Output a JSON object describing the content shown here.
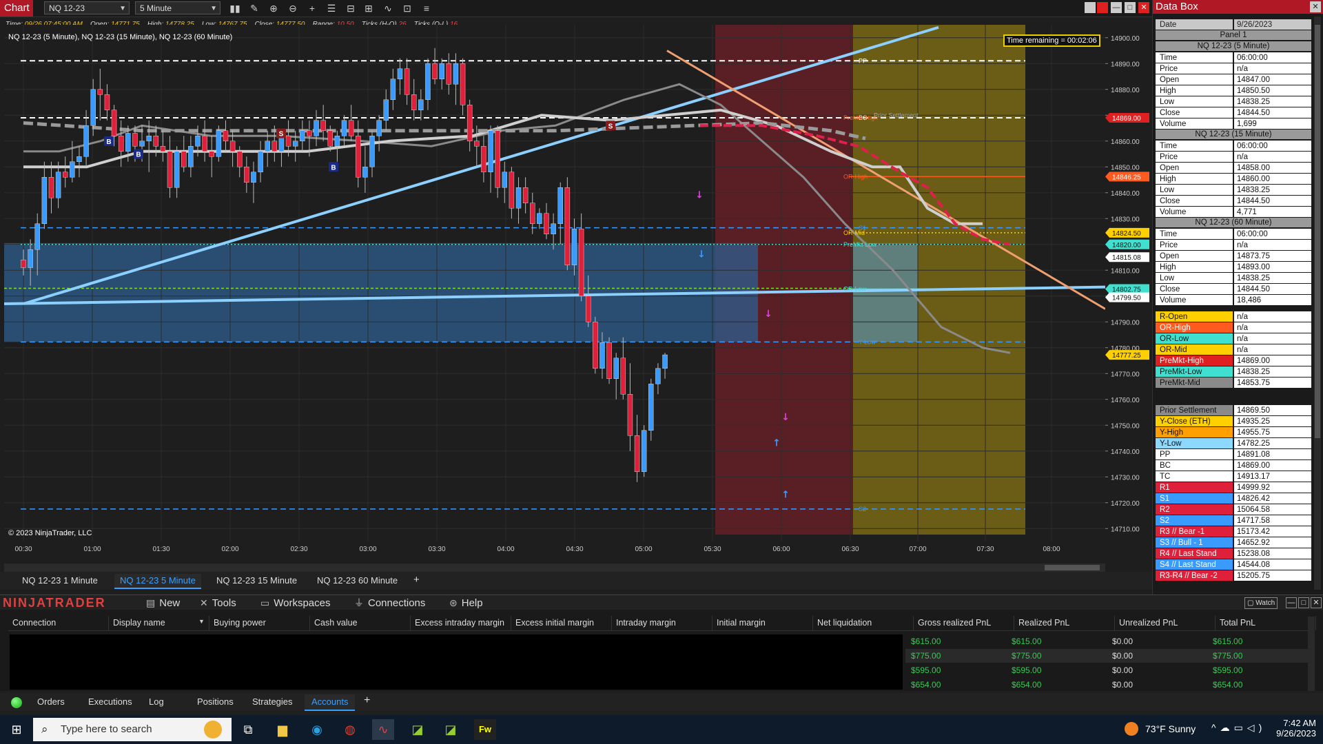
{
  "toolbar": {
    "title": "Chart",
    "instrument": "NQ 12-23",
    "interval": "5 Minute"
  },
  "infobar": {
    "time_label": "Time:",
    "time": "09/26 07:45:00 AM",
    "open_label": "Open:",
    "open": "14771.75",
    "high_label": "High:",
    "high": "14778.25",
    "low_label": "Low:",
    "low": "14767.75",
    "close_label": "Close:",
    "close": "14777.50",
    "range_label": "Range:",
    "range": "10.50",
    "ticks_ho_label": "Ticks (H-O)",
    "ticks_ho": "26",
    "ticks_ol_label": "Ticks (O-L)",
    "ticks_ol": "16"
  },
  "series_line": "NQ 12-23 (5 Minute), NQ 12-23 (15 Minute), NQ 12-23 (60 Minute)",
  "copyright": "© 2023 NinjaTrader, LLC",
  "time_remaining": "Time remaining = 00:02:06",
  "chart_data": {
    "type": "candlestick",
    "ylim": [
      14705,
      14905
    ],
    "yticks": [
      "14900.00",
      "14890.00",
      "14880.00",
      "14870.00",
      "14860.00",
      "14850.00",
      "14840.00",
      "14830.00",
      "14820.00",
      "14810.00",
      "14800.00",
      "14790.00",
      "14780.00",
      "14770.00",
      "14760.00",
      "14750.00",
      "14740.00",
      "14730.00",
      "14720.00",
      "14710.00"
    ],
    "x_labels": [
      "00:30",
      "01:00",
      "01:30",
      "02:00",
      "02:30",
      "03:00",
      "03:30",
      "04:00",
      "04:30",
      "05:00",
      "05:30",
      "06:00",
      "06:30",
      "07:00",
      "07:30",
      "08:00"
    ],
    "level_lines": [
      {
        "name": "PP",
        "value": 14891.08,
        "color": "#ffffff",
        "style": "dash"
      },
      {
        "name": "BC",
        "value": 14869.0,
        "color": "#ffffff",
        "style": "dash"
      },
      {
        "name": "S1",
        "value": 14826.42,
        "color": "#3a9bff",
        "style": "dash"
      },
      {
        "name": "Y-Low",
        "value": 14782.25,
        "color": "#3a9bff",
        "style": "dash"
      },
      {
        "name": "S2",
        "value": 14717.58,
        "color": "#3a9bff",
        "style": "dash"
      },
      {
        "name": "OR-High",
        "value": 14846.25,
        "color": "#ff5a1f",
        "style": "solid"
      },
      {
        "name": "OR-Mid",
        "value": 14824.5,
        "color": "#ffd000",
        "style": "dot"
      },
      {
        "name": "PreMkt-Low",
        "value": 14820.0,
        "color": "#40e0d0",
        "style": "dot"
      },
      {
        "name": "OR-Low",
        "value": 14802.75,
        "color": "#40e0d0",
        "style": "solid"
      }
    ],
    "level_labels": [
      "PP",
      "BC",
      "PreMkt-High",
      "Prior Settlement",
      "OR-High",
      "S1",
      "OR-Mid",
      "PreMkt-Low",
      "OR-Low",
      "Y-Low",
      "S2"
    ],
    "price_tags": [
      {
        "label": "14869.00",
        "value": 14869.0,
        "bg": "#e02020",
        "fg": "#fff"
      },
      {
        "label": "14846.25",
        "value": 14846.25,
        "bg": "#ff5a1f",
        "fg": "#fff"
      },
      {
        "label": "14824.50",
        "value": 14824.5,
        "bg": "#ffd000",
        "fg": "#111"
      },
      {
        "label": "14820.00",
        "value": 14820.0,
        "bg": "#40e0d0",
        "fg": "#111"
      },
      {
        "label": "14815.08",
        "value": 14815.08,
        "bg": "#ffffff",
        "fg": "#111"
      },
      {
        "label": "14802.75",
        "value": 14802.75,
        "bg": "#40e0d0",
        "fg": "#111"
      },
      {
        "label": "14799.50",
        "value": 14799.5,
        "bg": "#ffffff",
        "fg": "#111"
      },
      {
        "label": "14777.25",
        "value": 14777.25,
        "bg": "#ffd000",
        "fg": "#111"
      }
    ],
    "markers": [
      {
        "text": "B",
        "bg": "#1b2b8a"
      },
      {
        "text": "B",
        "bg": "#1b2b8a"
      },
      {
        "text": "B",
        "bg": "#1b2b8a"
      },
      {
        "text": "S",
        "bg": "#8a1b1b"
      },
      {
        "text": "S",
        "bg": "#8a1b1b"
      }
    ],
    "candles": [
      [
        14814,
        14818,
        14808,
        14811
      ],
      [
        14811,
        14822,
        14804,
        14818
      ],
      [
        14818,
        14832,
        14808,
        14828
      ],
      [
        14828,
        14852,
        14826,
        14846
      ],
      [
        14846,
        14852,
        14832,
        14838
      ],
      [
        14838,
        14852,
        14834,
        14848
      ],
      [
        14848,
        14854,
        14842,
        14846
      ],
      [
        14846,
        14860,
        14844,
        14852
      ],
      [
        14852,
        14858,
        14846,
        14854
      ],
      [
        14854,
        14872,
        14850,
        14866
      ],
      [
        14866,
        14884,
        14862,
        14880
      ],
      [
        14880,
        14888,
        14868,
        14878
      ],
      [
        14878,
        14882,
        14868,
        14872
      ],
      [
        14872,
        14874,
        14858,
        14862
      ],
      [
        14862,
        14868,
        14850,
        14856
      ],
      [
        14856,
        14866,
        14852,
        14863
      ],
      [
        14863,
        14866,
        14852,
        14858
      ],
      [
        14858,
        14866,
        14852,
        14860
      ],
      [
        14860,
        14868,
        14848,
        14862
      ],
      [
        14862,
        14866,
        14854,
        14858
      ],
      [
        14858,
        14864,
        14852,
        14856
      ],
      [
        14856,
        14862,
        14838,
        14842
      ],
      [
        14842,
        14858,
        14838,
        14856
      ],
      [
        14856,
        14862,
        14848,
        14850
      ],
      [
        14850,
        14862,
        14846,
        14858
      ],
      [
        14858,
        14866,
        14854,
        14862
      ],
      [
        14862,
        14868,
        14852,
        14856
      ],
      [
        14856,
        14862,
        14846,
        14854
      ],
      [
        14854,
        14866,
        14852,
        14864
      ],
      [
        14864,
        14868,
        14856,
        14860
      ],
      [
        14860,
        14864,
        14850,
        14856
      ],
      [
        14856,
        14858,
        14846,
        14850
      ],
      [
        14850,
        14854,
        14840,
        14844
      ],
      [
        14844,
        14852,
        14836,
        14848
      ],
      [
        14848,
        14860,
        14844,
        14856
      ],
      [
        14856,
        14864,
        14850,
        14860
      ],
      [
        14860,
        14866,
        14852,
        14856
      ],
      [
        14856,
        14864,
        14850,
        14862
      ],
      [
        14862,
        14868,
        14854,
        14858
      ],
      [
        14858,
        14864,
        14852,
        14860
      ],
      [
        14860,
        14868,
        14856,
        14864
      ],
      [
        14864,
        14868,
        14854,
        14862
      ],
      [
        14862,
        14872,
        14858,
        14868
      ],
      [
        14868,
        14874,
        14860,
        14864
      ],
      [
        14864,
        14866,
        14856,
        14858
      ],
      [
        14858,
        14864,
        14852,
        14862
      ],
      [
        14862,
        14870,
        14858,
        14868
      ],
      [
        14868,
        14874,
        14860,
        14862
      ],
      [
        14862,
        14868,
        14842,
        14846
      ],
      [
        14846,
        14858,
        14840,
        14850
      ],
      [
        14850,
        14864,
        14846,
        14862
      ],
      [
        14862,
        14870,
        14856,
        14868
      ],
      [
        14868,
        14880,
        14864,
        14876
      ],
      [
        14876,
        14888,
        14872,
        14884
      ],
      [
        14884,
        14892,
        14878,
        14888
      ],
      [
        14888,
        14892,
        14874,
        14878
      ],
      [
        14878,
        14884,
        14868,
        14872
      ],
      [
        14872,
        14880,
        14868,
        14876
      ],
      [
        14876,
        14892,
        14872,
        14890
      ],
      [
        14890,
        14896,
        14882,
        14884
      ],
      [
        14884,
        14892,
        14880,
        14890
      ],
      [
        14890,
        14894,
        14878,
        14882
      ],
      [
        14882,
        14894,
        14874,
        14890
      ],
      [
        14890,
        14892,
        14870,
        14874
      ],
      [
        14874,
        14876,
        14856,
        14860
      ],
      [
        14860,
        14866,
        14850,
        14858
      ],
      [
        14858,
        14862,
        14844,
        14848
      ],
      [
        14848,
        14866,
        14840,
        14864
      ],
      [
        14864,
        14866,
        14838,
        14842
      ],
      [
        14842,
        14852,
        14836,
        14848
      ],
      [
        14848,
        14850,
        14830,
        14834
      ],
      [
        14834,
        14846,
        14828,
        14842
      ],
      [
        14842,
        14846,
        14832,
        14836
      ],
      [
        14836,
        14840,
        14824,
        14828
      ],
      [
        14828,
        14834,
        14826,
        14832
      ],
      [
        14832,
        14836,
        14822,
        14824
      ],
      [
        14824,
        14832,
        14818,
        14828
      ],
      [
        14828,
        14844,
        14820,
        14842
      ],
      [
        14842,
        14846,
        14810,
        14812
      ],
      [
        14812,
        14830,
        14808,
        14826
      ],
      [
        14826,
        14832,
        14798,
        14800
      ],
      [
        14800,
        14808,
        14788,
        14790
      ],
      [
        14790,
        14792,
        14770,
        14772
      ],
      [
        14772,
        14786,
        14768,
        14782
      ],
      [
        14782,
        14784,
        14766,
        14768
      ],
      [
        14768,
        14778,
        14760,
        14776
      ],
      [
        14776,
        14784,
        14760,
        14762
      ],
      [
        14762,
        14774,
        14740,
        14746
      ],
      [
        14746,
        14754,
        14728,
        14732
      ],
      [
        14732,
        14750,
        14730,
        14748
      ],
      [
        14748,
        14768,
        14744,
        14766
      ],
      [
        14766,
        14774,
        14762,
        14772
      ],
      [
        14772,
        14778,
        14768,
        14777.25
      ]
    ],
    "bull_color": "#3a9bff",
    "bear_color": "#e0203a"
  },
  "chart_tabs": [
    "NQ 12-23 1 Minute",
    "NQ 12-23 5 Minute",
    "NQ 12-23 15 Minute",
    "NQ 12-23 60 Minute"
  ],
  "chart_tabs_active": 1,
  "add_tab": "+",
  "databox": {
    "title": "Data Box",
    "date_label": "Date",
    "date_value": "9/26/2023",
    "panel": "Panel 1",
    "sections": [
      {
        "title": "NQ 12-23 (5 Minute)",
        "rows": [
          [
            "Time",
            "06:00:00"
          ],
          [
            "Price",
            "n/a"
          ],
          [
            "Open",
            "14847.00"
          ],
          [
            "High",
            "14850.50"
          ],
          [
            "Low",
            "14838.25"
          ],
          [
            "Close",
            "14844.50"
          ],
          [
            "Volume",
            "1,699"
          ]
        ]
      },
      {
        "title": "NQ 12-23 (15 Minute)",
        "rows": [
          [
            "Time",
            "06:00:00"
          ],
          [
            "Price",
            "n/a"
          ],
          [
            "Open",
            "14858.00"
          ],
          [
            "High",
            "14860.00"
          ],
          [
            "Low",
            "14838.25"
          ],
          [
            "Close",
            "14844.50"
          ],
          [
            "Volume",
            "4,771"
          ]
        ]
      },
      {
        "title": "NQ 12-23 (60 Minute)",
        "rows": [
          [
            "Time",
            "06:00:00"
          ],
          [
            "Price",
            "n/a"
          ],
          [
            "Open",
            "14873.75"
          ],
          [
            "High",
            "14893.00"
          ],
          [
            "Low",
            "14838.25"
          ],
          [
            "Close",
            "14844.50"
          ],
          [
            "Volume",
            "18,486"
          ]
        ]
      }
    ],
    "levels": [
      {
        "k": "R-Open",
        "v": "n/a",
        "bg": "#ffd000",
        "fg": "#111"
      },
      {
        "k": "OR-High",
        "v": "n/a",
        "bg": "#ff5a1f",
        "fg": "#fff"
      },
      {
        "k": "OR-Low",
        "v": "n/a",
        "bg": "#40e0d0",
        "fg": "#111"
      },
      {
        "k": "OR-Mid",
        "v": "n/a",
        "bg": "#ffd000",
        "fg": "#111"
      },
      {
        "k": "PreMkt-High",
        "v": "14869.00",
        "bg": "#e02020",
        "fg": "#fff"
      },
      {
        "k": "PreMkt-Low",
        "v": "14838.25",
        "bg": "#40e0d0",
        "fg": "#111"
      },
      {
        "k": "PreMkt-Mid",
        "v": "14853.75",
        "bg": "#8a8a8a",
        "fg": "#111"
      }
    ],
    "levels2": [
      {
        "k": "Prior Settlement",
        "v": "14869.50",
        "bg": "#8a8a8a",
        "fg": "#111"
      },
      {
        "k": "Y-Close (ETH)",
        "v": "14935.25",
        "bg": "#ffd000",
        "fg": "#111"
      },
      {
        "k": "Y-High",
        "v": "14955.75",
        "bg": "#ffa000",
        "fg": "#111"
      },
      {
        "k": "Y-Low",
        "v": "14782.25",
        "bg": "#8cd8ff",
        "fg": "#111"
      },
      {
        "k": "PP",
        "v": "14891.08",
        "bg": "#ffffff",
        "fg": "#111"
      },
      {
        "k": "BC",
        "v": "14869.00",
        "bg": "#ffffff",
        "fg": "#111"
      },
      {
        "k": "TC",
        "v": "14913.17",
        "bg": "#ffffff",
        "fg": "#111"
      },
      {
        "k": "R1",
        "v": "14999.92",
        "bg": "#e0203a",
        "fg": "#fff"
      },
      {
        "k": "S1",
        "v": "14826.42",
        "bg": "#3a9bff",
        "fg": "#fff"
      },
      {
        "k": "R2",
        "v": "15064.58",
        "bg": "#e0203a",
        "fg": "#fff"
      },
      {
        "k": "S2",
        "v": "14717.58",
        "bg": "#3a9bff",
        "fg": "#fff"
      },
      {
        "k": "R3 // Bear -1",
        "v": "15173.42",
        "bg": "#e0203a",
        "fg": "#fff"
      },
      {
        "k": "S3 // Bull - 1",
        "v": "14652.92",
        "bg": "#3a9bff",
        "fg": "#fff"
      },
      {
        "k": "R4 // Last Stand",
        "v": "15238.08",
        "bg": "#e0203a",
        "fg": "#fff"
      },
      {
        "k": "S4 // Last Stand",
        "v": "14544.08",
        "bg": "#3a9bff",
        "fg": "#fff"
      },
      {
        "k": "R3-R4 // Bear -2",
        "v": "15205.75",
        "bg": "#e0203a",
        "fg": "#fff"
      }
    ]
  },
  "control_center": {
    "logo": "NINJATRADER",
    "menus": [
      "New",
      "Tools",
      "Workspaces",
      "Connections",
      "Help"
    ],
    "watch": "Watch"
  },
  "accounts": {
    "columns": [
      "Connection",
      "Display name",
      "Buying power",
      "Cash value",
      "Excess intraday margin",
      "Excess initial margin",
      "Intraday margin",
      "Initial margin",
      "Net liquidation",
      "Gross realized PnL",
      "Realized PnL",
      "Unrealized PnL",
      "Total PnL"
    ],
    "rows": [
      [
        "$615.00",
        "$615.00",
        "$0.00",
        "$615.00"
      ],
      [
        "$775.00",
        "$775.00",
        "$0.00",
        "$775.00"
      ],
      [
        "$595.00",
        "$595.00",
        "$0.00",
        "$595.00"
      ],
      [
        "$654.00",
        "$654.00",
        "$0.00",
        "$654.00"
      ]
    ]
  },
  "bottom_tabs": [
    "Orders",
    "Executions",
    "Log",
    "Positions",
    "Strategies",
    "Accounts"
  ],
  "bottom_tabs_active": 5,
  "taskbar": {
    "search_placeholder": "Type here to search",
    "weather": "73°F  Sunny",
    "time": "7:42 AM",
    "date": "9/26/2023"
  }
}
